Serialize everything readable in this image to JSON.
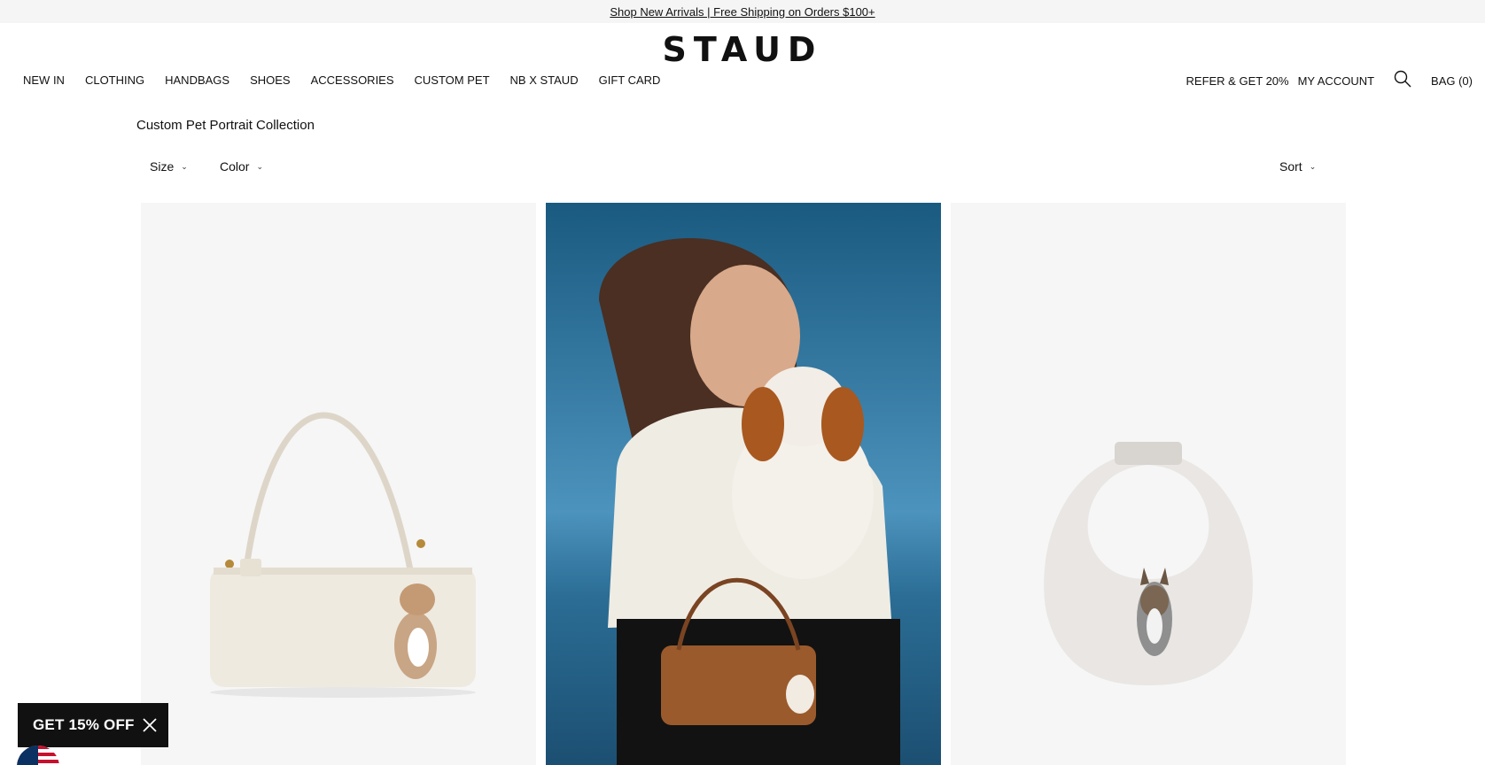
{
  "announcement": {
    "text": "Shop New Arrivals | Free Shipping on Orders $100+"
  },
  "brand": {
    "logo": "STAUD"
  },
  "nav": {
    "left": [
      "NEW IN",
      "CLOTHING",
      "HANDBAGS",
      "SHOES",
      "ACCESSORIES",
      "CUSTOM PET",
      "NB X STAUD",
      "GIFT CARD"
    ],
    "refer": "REFER & GET 20%",
    "account": "MY ACCOUNT",
    "search_icon": "search-icon",
    "bag": "BAG (0)"
  },
  "collection": {
    "title": "Custom Pet Portrait Collection"
  },
  "filters": {
    "size": "Size",
    "color": "Color",
    "sort": "Sort"
  },
  "products": [
    {
      "image": "cream-shoulder-bag-with-dog-portrait"
    },
    {
      "image": "woman-holding-dog-with-brown-bag"
    },
    {
      "image": "grey-moon-bag-with-dog-portrait"
    }
  ],
  "promo": {
    "label": "GET 15% OFF",
    "close_icon": "close-icon"
  },
  "locale": {
    "flag_icon": "us-flag-icon"
  },
  "colors": {
    "text": "#111111",
    "announcement_bg": "#f5f5f5",
    "tile_bg": "#f6f6f6",
    "promo_bg": "#111111"
  }
}
